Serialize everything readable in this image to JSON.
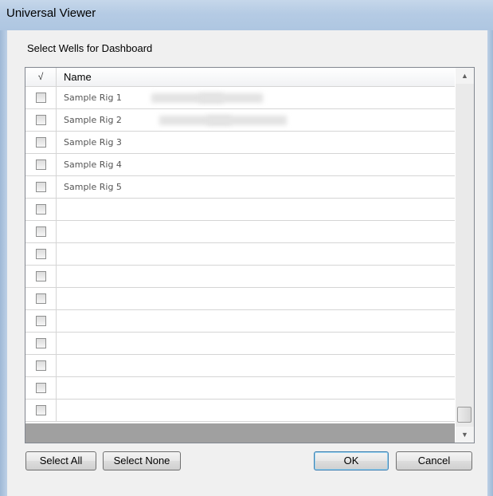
{
  "window": {
    "title": "Universal Viewer"
  },
  "caption": "Select Wells for Dashboard",
  "table": {
    "headers": {
      "check": "√",
      "name": "Name"
    },
    "rows": [
      {
        "name": "Sample Rig 1",
        "checked": false
      },
      {
        "name": "Sample Rig 2",
        "checked": false
      },
      {
        "name": "Sample Rig 3",
        "checked": false
      },
      {
        "name": "Sample Rig 4",
        "checked": false
      },
      {
        "name": "Sample Rig 5",
        "checked": false
      },
      {
        "name": "",
        "checked": false
      },
      {
        "name": "",
        "checked": false
      },
      {
        "name": "",
        "checked": false
      },
      {
        "name": "",
        "checked": false
      },
      {
        "name": "",
        "checked": false
      },
      {
        "name": "",
        "checked": false
      },
      {
        "name": "",
        "checked": false
      },
      {
        "name": "",
        "checked": false
      },
      {
        "name": "",
        "checked": false
      },
      {
        "name": "",
        "checked": false
      }
    ]
  },
  "scrollbar": {
    "up_icon": "arrow-up-icon",
    "down_icon": "arrow-down-icon"
  },
  "buttons": {
    "select_all": "Select All",
    "select_none": "Select None",
    "ok": "OK",
    "cancel": "Cancel"
  },
  "colors": {
    "titlebar": "#b5cbe4",
    "dialog_bg": "#f0f0f0",
    "default_button_border": "#3c7fb1"
  }
}
